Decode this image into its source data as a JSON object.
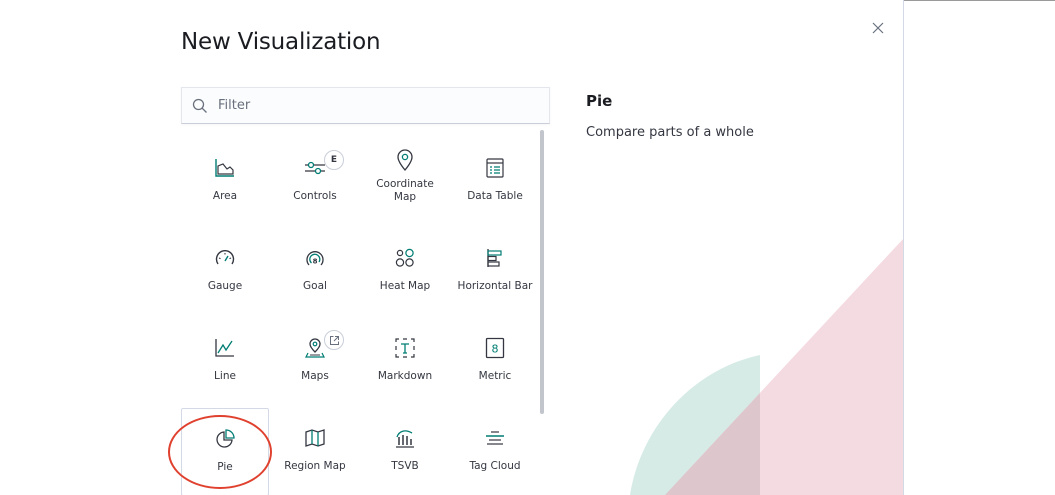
{
  "modal": {
    "title": "New Visualization",
    "close_icon": "close-icon"
  },
  "search": {
    "placeholder": "Filter",
    "value": "",
    "icon": "search-icon"
  },
  "tiles": [
    {
      "label": "Area",
      "icon": "area-chart-icon"
    },
    {
      "label": "Controls",
      "icon": "controls-icon",
      "badge": "E"
    },
    {
      "label": "Coordinate Map",
      "icon": "map-pin-icon"
    },
    {
      "label": "Data Table",
      "icon": "table-icon"
    },
    {
      "label": "Gauge",
      "icon": "gauge-icon"
    },
    {
      "label": "Goal",
      "icon": "goal-icon"
    },
    {
      "label": "Heat Map",
      "icon": "heatmap-icon"
    },
    {
      "label": "Horizontal Bar",
      "icon": "horizontal-bar-icon"
    },
    {
      "label": "Line",
      "icon": "line-chart-icon"
    },
    {
      "label": "Maps",
      "icon": "maps-icon",
      "badge_icon": "external-link-icon"
    },
    {
      "label": "Markdown",
      "icon": "markdown-icon"
    },
    {
      "label": "Metric",
      "icon": "metric-icon"
    },
    {
      "label": "Pie",
      "icon": "pie-chart-icon",
      "selected": true
    },
    {
      "label": "Region Map",
      "icon": "region-map-icon"
    },
    {
      "label": "TSVB",
      "icon": "tsvb-icon"
    },
    {
      "label": "Tag Cloud",
      "icon": "tag-cloud-icon"
    }
  ],
  "detail": {
    "title": "Pie",
    "description": "Compare parts of a whole"
  },
  "colors": {
    "icon_accent": "#017d73",
    "annotation": "#e0412f",
    "deco_pink": "#f2d4dc",
    "deco_teal": "#d6ebe6"
  }
}
